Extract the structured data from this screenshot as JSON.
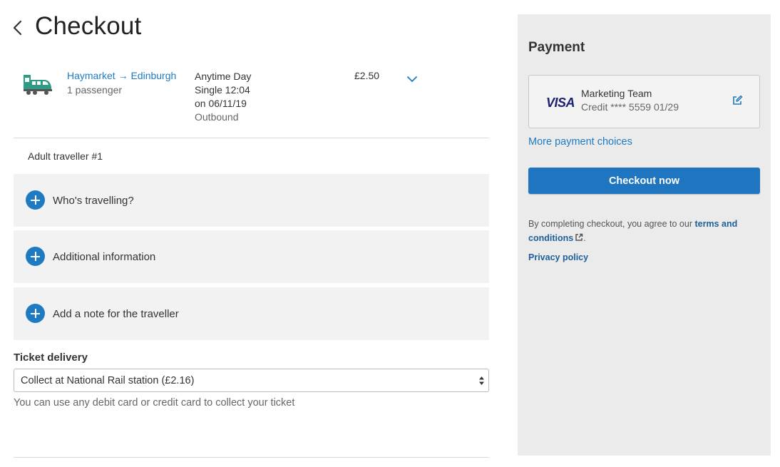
{
  "header": {
    "title": "Checkout",
    "back_icon": "chevron-left-icon"
  },
  "journey": {
    "icon": "train-icon",
    "route": "Haymarket → Edinburgh",
    "passengers": "1 passenger",
    "fare_type": "Anytime Day",
    "fare_time": "Single 12:04",
    "fare_date": "on 06/11/19",
    "direction": "Outbound",
    "price": "£2.50",
    "expand_icon": "chevron-down-icon"
  },
  "traveller": {
    "heading": "Adult traveller #1",
    "sections": [
      {
        "label": "Who's travelling?",
        "icon": "plus-circle-icon"
      },
      {
        "label": "Additional information",
        "icon": "plus-circle-icon"
      },
      {
        "label": "Add a note for the traveller",
        "icon": "plus-circle-icon"
      }
    ]
  },
  "delivery": {
    "label": "Ticket delivery",
    "selected": "Collect at National Rail station (£2.16)",
    "hint": "You can use any debit card or credit card to collect your ticket"
  },
  "payment": {
    "title": "Payment",
    "card": {
      "brand": "VISA",
      "name": "Marketing Team",
      "details": "Credit **** 5559 01/29",
      "edit_icon": "edit-icon"
    },
    "more_choices": "More payment choices",
    "checkout_button": "Checkout now",
    "terms_prefix": "By completing checkout, you agree to our ",
    "terms_link": "terms and conditions",
    "terms_suffix": ".",
    "privacy": "Privacy policy"
  },
  "colors": {
    "link": "#1f7bc1",
    "primary_button": "#1f75c0",
    "panel_background": "#ebebeb",
    "section_background": "#f2f2f3",
    "train_green": "#2e9c85"
  }
}
